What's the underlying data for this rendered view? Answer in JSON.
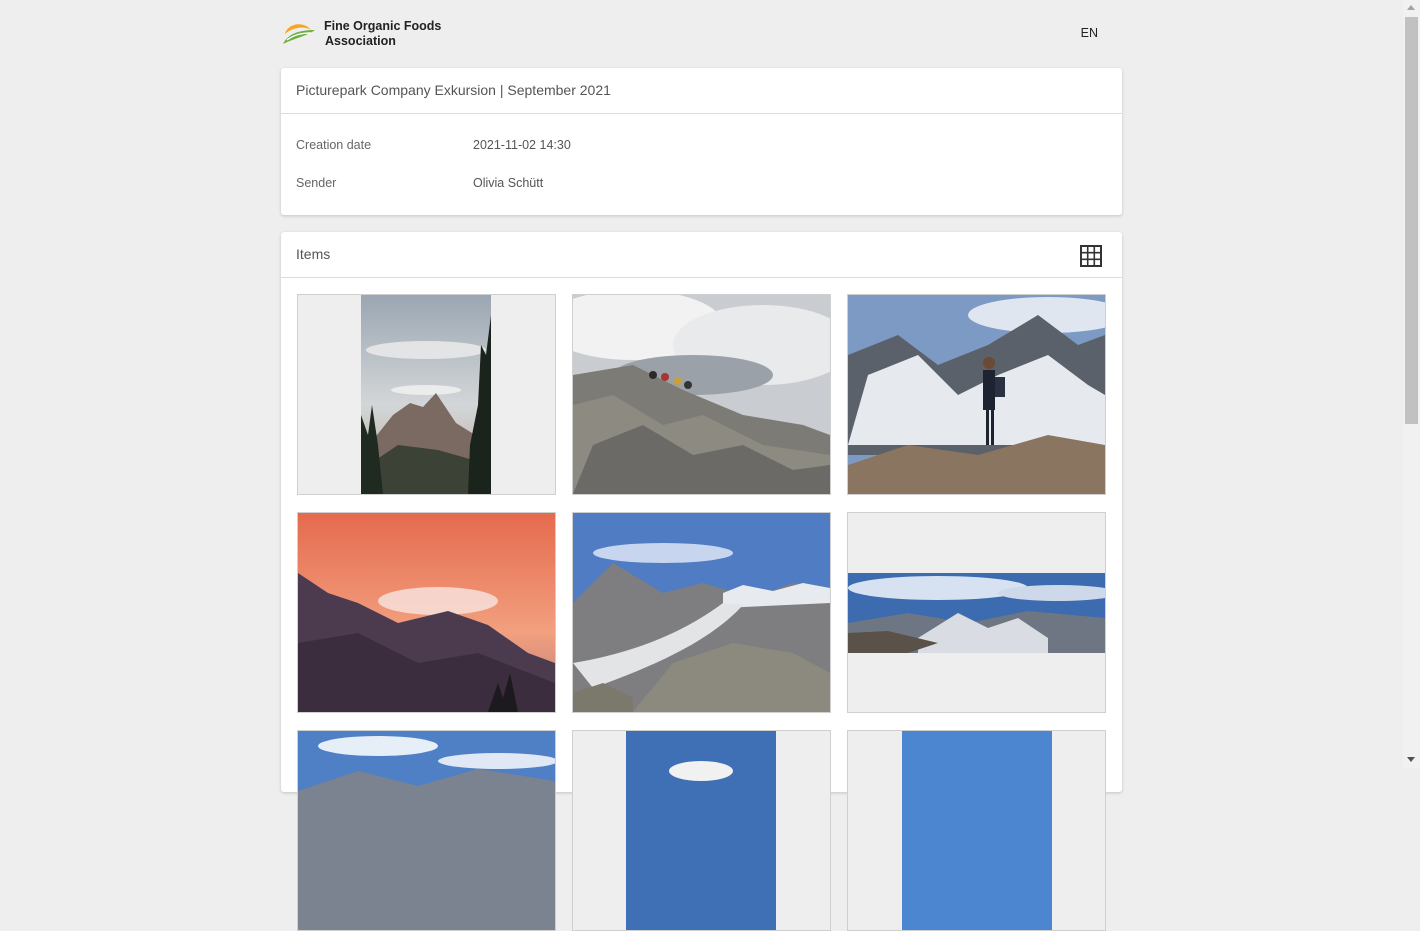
{
  "header": {
    "brand_line1": "Fine Organic Foods",
    "brand_line2": "Association",
    "language": "EN"
  },
  "share": {
    "title": "Picturepark Company Exkursion | September 2021",
    "creation_date_label": "Creation date",
    "creation_date_value": "2021-11-02 14:30",
    "sender_label": "Sender",
    "sender_value": "Olivia Schütt"
  },
  "items": {
    "title": "Items",
    "view_icon": "grid-icon",
    "thumbnails": [
      {
        "name": "mountain-clouds-portrait"
      },
      {
        "name": "rocky-summit-hikers"
      },
      {
        "name": "hiker-glacier-peak"
      },
      {
        "name": "sunset-lenticular-cloud"
      },
      {
        "name": "aletsch-glacier-valley"
      },
      {
        "name": "alpine-panorama"
      },
      {
        "name": "blue-sky-mountains"
      },
      {
        "name": "summit-sign"
      },
      {
        "name": "blue-sky-portrait"
      }
    ]
  },
  "colors": {
    "background": "#eeeeee",
    "card": "#ffffff",
    "logo_orange": "#f5a623",
    "logo_green": "#6cae3f"
  }
}
